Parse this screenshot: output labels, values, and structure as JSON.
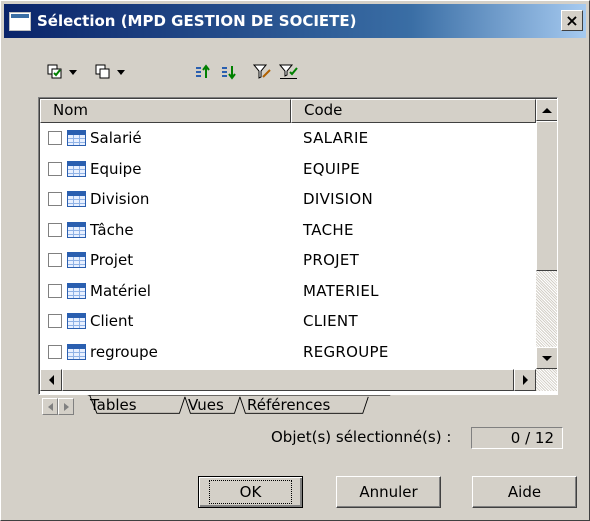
{
  "window": {
    "title": "Sélection (MPD GESTION DE SOCIETE)",
    "close_label": "×"
  },
  "toolbar": {
    "icons": [
      "select-all-icon",
      "deselect-all-icon",
      "move-to-top-icon",
      "move-to-bottom-icon",
      "filter-icon",
      "filter-selection-icon"
    ]
  },
  "list": {
    "columns": {
      "name": "Nom",
      "code": "Code"
    },
    "rows": [
      {
        "name": "Salarié",
        "code": "SALARIE",
        "checked": false
      },
      {
        "name": "Equipe",
        "code": "EQUIPE",
        "checked": false
      },
      {
        "name": "Division",
        "code": "DIVISION",
        "checked": false
      },
      {
        "name": "Tâche",
        "code": "TACHE",
        "checked": false
      },
      {
        "name": "Projet",
        "code": "PROJET",
        "checked": false
      },
      {
        "name": "Matériel",
        "code": "MATERIEL",
        "checked": false
      },
      {
        "name": "Client",
        "code": "CLIENT",
        "checked": false
      },
      {
        "name": "regroupe",
        "code": "REGROUPE",
        "checked": false
      }
    ]
  },
  "tabs": [
    "Tables",
    "Vues",
    "Références"
  ],
  "status": {
    "label": "Objet(s) sélectionné(s) :",
    "value": "0 / 12"
  },
  "buttons": {
    "ok": "OK",
    "cancel": "Annuler",
    "help": "Aide"
  },
  "colors": {
    "titlebar_start": "#0a246a",
    "titlebar_end": "#a6caf0",
    "face": "#d4d0c8"
  }
}
